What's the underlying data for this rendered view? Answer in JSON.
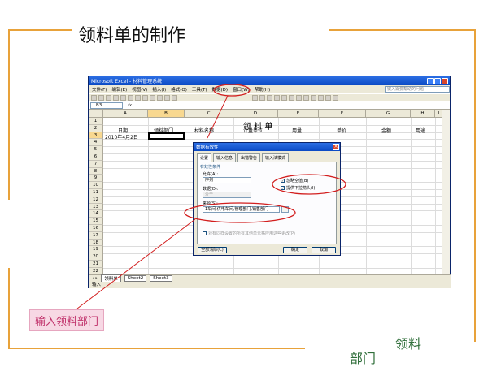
{
  "slide": {
    "title": "领料单的制作",
    "callout": "输入领料部门",
    "corner_word_1": "领料",
    "corner_word_2": "部门",
    "accent_color": "#e8a23a"
  },
  "excel": {
    "window_title": "Microsoft Excel - 材料管理系统",
    "menu": [
      "文件(F)",
      "编辑(E)",
      "视图(V)",
      "插入(I)",
      "格式(O)",
      "工具(T)",
      "数据(D)",
      "窗口(W)",
      "帮助(H)"
    ],
    "help_placeholder": "键入需要帮助的问题",
    "name_box": "B3",
    "columns": [
      "A",
      "B",
      "C",
      "D",
      "E",
      "F",
      "G",
      "H",
      "I"
    ],
    "rows": [
      "1",
      "2",
      "3",
      "4",
      "5",
      "6",
      "7",
      "8",
      "9",
      "10",
      "11",
      "12",
      "13",
      "14",
      "15",
      "16",
      "17",
      "18",
      "19",
      "20",
      "21",
      "22"
    ],
    "sheet_title": "领 料 单",
    "headers": [
      "日期",
      "领料部门",
      "材料名称",
      "计量单位",
      "用量",
      "单价",
      "金额",
      "用途"
    ],
    "a3_value": "2010年4月2日",
    "sheet_tabs": [
      "领料单",
      "Sheet2",
      "Sheet3"
    ],
    "status": "输入"
  },
  "dialog": {
    "title": "数据有效性",
    "tabs": [
      "设置",
      "输入信息",
      "出错警告",
      "输入法模式"
    ],
    "section": "有效性条件",
    "allow_label": "允许(A):",
    "allow_value": "序列",
    "data_label": "数据(D):",
    "data_value": "介于",
    "ignore_blank": "忽略空值(B)",
    "dropdown": "提供下拉箭头(I)",
    "source_label": "来源(S):",
    "source_value": "1车间,供电车间,管理部门,销售部门",
    "apply_all": "对有同样设置的所有其他单元格应用这些更改(P)",
    "clear_btn": "全部清除(C)",
    "ok_btn": "确定",
    "cancel_btn": "取消"
  }
}
